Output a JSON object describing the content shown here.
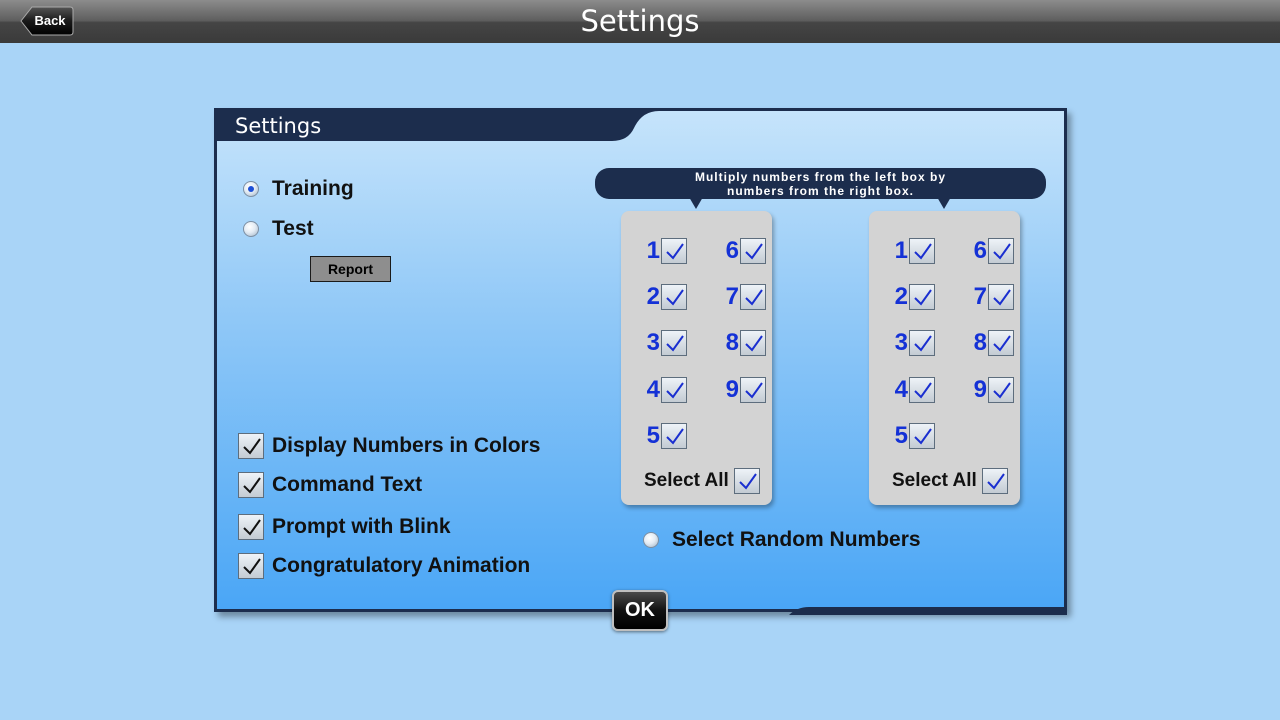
{
  "topbar": {
    "title": "Settings",
    "back_label": "Back"
  },
  "panel": {
    "title": "Settings",
    "mode_options": [
      {
        "label": "Training",
        "selected": true
      },
      {
        "label": "Test",
        "selected": false
      }
    ],
    "report_label": "Report",
    "display_options": [
      {
        "label": "Display Numbers in Colors",
        "checked": true
      },
      {
        "label": "Command Text",
        "checked": true
      },
      {
        "label": "Prompt with Blink",
        "checked": true
      },
      {
        "label": "Congratulatory Animation",
        "checked": true
      }
    ],
    "banner_line1": "Multiply numbers from the left box by",
    "banner_line2": "numbers from the right box.",
    "left_box": {
      "numbers": [
        "1",
        "2",
        "3",
        "4",
        "5",
        "6",
        "7",
        "8",
        "9"
      ],
      "select_all_label": "Select All"
    },
    "right_box": {
      "numbers": [
        "1",
        "2",
        "3",
        "4",
        "5",
        "6",
        "7",
        "8",
        "9"
      ],
      "select_all_label": "Select All"
    },
    "random_label": "Select Random Numbers",
    "random_selected": false
  },
  "ok_label": "OK",
  "colors": {
    "background": "#a9d4f7",
    "panel_navy": "#1c2d4d",
    "digit_blue": "#1431d6",
    "check_blue": "#1a2fd0"
  },
  "icons": {
    "checkmark": "check-icon",
    "back": "back-arrow-icon"
  }
}
